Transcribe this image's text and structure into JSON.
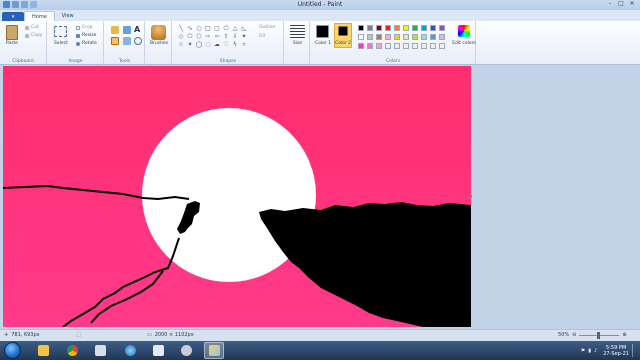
{
  "window": {
    "title": "Untitled - Paint"
  },
  "tabs": {
    "file": "",
    "home": "Home",
    "view": "View"
  },
  "ribbon": {
    "clipboard": {
      "paste": "Paste",
      "cut": "Cut",
      "copy": "Copy",
      "label": "Clipboard"
    },
    "image": {
      "select": "Select",
      "crop": "Crop",
      "resize": "Resize",
      "rotate": "Rotate",
      "label": "Image"
    },
    "tools": {
      "label": "Tools"
    },
    "brushes": {
      "label": "Brushes"
    },
    "shapes": {
      "outline": "Outline",
      "fill": "Fill",
      "label": "Shapes"
    },
    "size": {
      "label": "Size"
    },
    "colors": {
      "color1": "Color 1",
      "color2": "Color 2",
      "edit": "Edit colors",
      "label": "Colors",
      "color1_value": "#000000",
      "color2_value": "#f7941d",
      "palette_row1": [
        "#000000",
        "#7f7f7f",
        "#880015",
        "#ed1c24",
        "#ff7f27",
        "#fff200",
        "#22b14c",
        "#00a2e8",
        "#3f48cc",
        "#a349a4"
      ],
      "palette_row2": [
        "#ffffff",
        "#c3c3c3",
        "#b97a57",
        "#ffaec9",
        "#ffc90e",
        "#efe4b0",
        "#b5e61d",
        "#99d9ea",
        "#7092be",
        "#c8bfe7"
      ],
      "palette_row3": [
        "#ff2dd6",
        "#ff6ad5",
        "#ff9ad8",
        "#f0f0f0",
        "#f0f0f0",
        "#f0f0f0",
        "#f0f0f0",
        "#f0f0f0",
        "#f0f0f0",
        "#f0f0f0"
      ]
    }
  },
  "canvas": {
    "background_top": "#ff2d6e",
    "background_bottom": "#ff3a8a",
    "sun_color": "#ffffff",
    "cliff_color": "#000000"
  },
  "status": {
    "cursor_pos": "781, 693px",
    "canvas_size": "2000 × 1102px",
    "zoom": "50%"
  },
  "taskbar": {
    "time": "5:59 PM",
    "date": "27-Sep-21"
  }
}
